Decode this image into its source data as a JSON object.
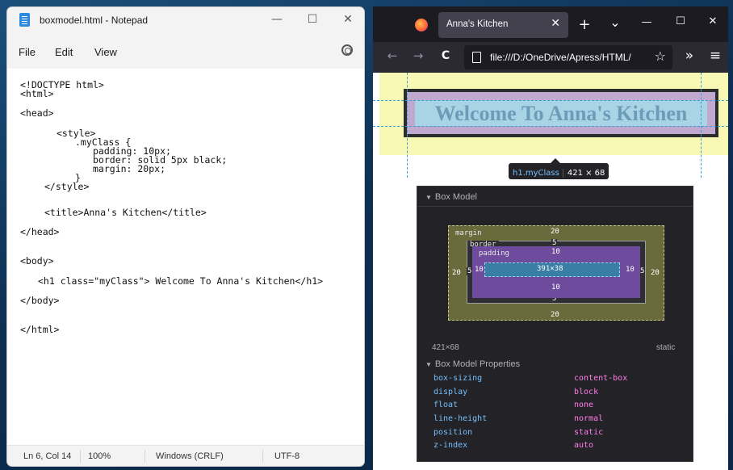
{
  "notepad": {
    "title": "boxmodel.html - Notepad",
    "window_buttons": {
      "minimize": "—",
      "maximize": "☐",
      "close": "✕"
    },
    "menu": [
      "File",
      "Edit",
      "View"
    ],
    "code_lines": [
      "<!DOCTYPE html>",
      "<html>",
      "<head>",
      "<style>",
      ".myClass {",
      "padding: 10px;",
      "border: solid 5px black;",
      "margin: 20px;",
      "}",
      "</style>",
      "<title>Anna's Kitchen</title>",
      "</head>",
      "<body>",
      "<h1 class=\"myClass\"> Welcome To Anna's Kitchen</h1>",
      "</body>",
      "</html>"
    ],
    "status": {
      "position": "Ln 6, Col 14",
      "zoom": "100%",
      "line_endings": "Windows (CRLF)",
      "encoding": "UTF-8"
    }
  },
  "firefox": {
    "tab_title": "Anna's Kitchen",
    "tab_close": "✕",
    "new_tab": "+",
    "tab_list": "⌄",
    "window_buttons": {
      "minimize": "—",
      "maximize": "☐",
      "close": "✕"
    },
    "nav": {
      "back": "←",
      "forward": "→",
      "reload": "C",
      "overflow": "»",
      "menu": "≡"
    },
    "url": "file:///D:/OneDrive/Apress/HTML/",
    "page": {
      "heading": "Welcome To Anna's Kitchen",
      "tooltip_selector": "h1.myClass",
      "tooltip_size": "421 × 68"
    },
    "devtools": {
      "box_model_title": "Box Model",
      "labels": {
        "margin": "margin",
        "border": "border",
        "padding": "padding"
      },
      "margin": {
        "top": "20",
        "right": "20",
        "bottom": "20",
        "left": "20"
      },
      "border": {
        "top": "5",
        "right": "5",
        "bottom": "5",
        "left": "5"
      },
      "padding": {
        "top": "10",
        "right": "10",
        "bottom": "10",
        "left": "10"
      },
      "content": "391×38",
      "element_size": "421×68",
      "position": "static",
      "properties_title": "Box Model Properties",
      "properties": [
        {
          "key": "box-sizing",
          "value": "content-box"
        },
        {
          "key": "display",
          "value": "block"
        },
        {
          "key": "float",
          "value": "none"
        },
        {
          "key": "line-height",
          "value": "normal"
        },
        {
          "key": "position",
          "value": "static"
        },
        {
          "key": "z-index",
          "value": "auto"
        }
      ]
    }
  }
}
